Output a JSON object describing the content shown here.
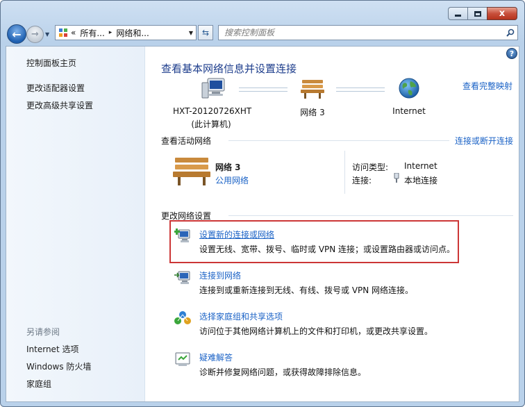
{
  "window": {
    "minimize_icon": "minimize-icon",
    "maximize_icon": "maximize-icon",
    "close_glyph": "x"
  },
  "nav": {
    "back_glyph": "←",
    "forward_glyph": "→",
    "breadcrumb": [
      "«",
      "所有...",
      "▸",
      "网络和..."
    ],
    "refresh_glyph": "⇆",
    "search_placeholder": "搜索控制面板"
  },
  "sidebar": {
    "top_links": [
      "控制面板主页",
      "更改适配器设置",
      "更改高级共享设置"
    ],
    "see_also_heading": "另请参阅",
    "see_also_links": [
      "Internet 选项",
      "Windows 防火墙",
      "家庭组"
    ]
  },
  "main": {
    "help_glyph": "?",
    "title": "查看基本网络信息并设置连接",
    "full_map_link": "查看完整映射",
    "map_nodes": [
      {
        "line1": "HXT-20120726XHT",
        "line2": "(此计算机)",
        "icon": "computer-icon"
      },
      {
        "line1": "网络  3",
        "line2": "",
        "icon": "bench-icon"
      },
      {
        "line1": "Internet",
        "line2": "",
        "icon": "globe-icon"
      }
    ],
    "active_networks": {
      "heading": "查看活动网络",
      "connect_link": "连接或断开连接",
      "network_name": "网络  3",
      "network_type": "公用网络",
      "access_type_label": "访问类型:",
      "access_type_value": "Internet",
      "connection_label": "连接:",
      "connection_value": "本地连接"
    },
    "change_settings": {
      "heading": "更改网络设置",
      "tasks": [
        {
          "link": "设置新的连接或网络",
          "desc": "设置无线、宽带、拨号、临时或 VPN 连接；或设置路由器或访问点。",
          "icon": "new-connection-icon"
        },
        {
          "link": "连接到网络",
          "desc": "连接到或重新连接到无线、有线、拨号或 VPN 网络连接。",
          "icon": "connect-network-icon"
        },
        {
          "link": "选择家庭组和共享选项",
          "desc": "访问位于其他网络计算机上的文件和打印机，或更改共享设置。",
          "icon": "homegroup-icon"
        },
        {
          "link": "疑难解答",
          "desc": "诊断并修复网络问题，或获得故障排除信息。",
          "icon": "troubleshoot-icon"
        }
      ]
    }
  },
  "colors": {
    "link": "#1a62c6",
    "title": "#1d3d8c",
    "highlight_border": "#cc3636"
  }
}
